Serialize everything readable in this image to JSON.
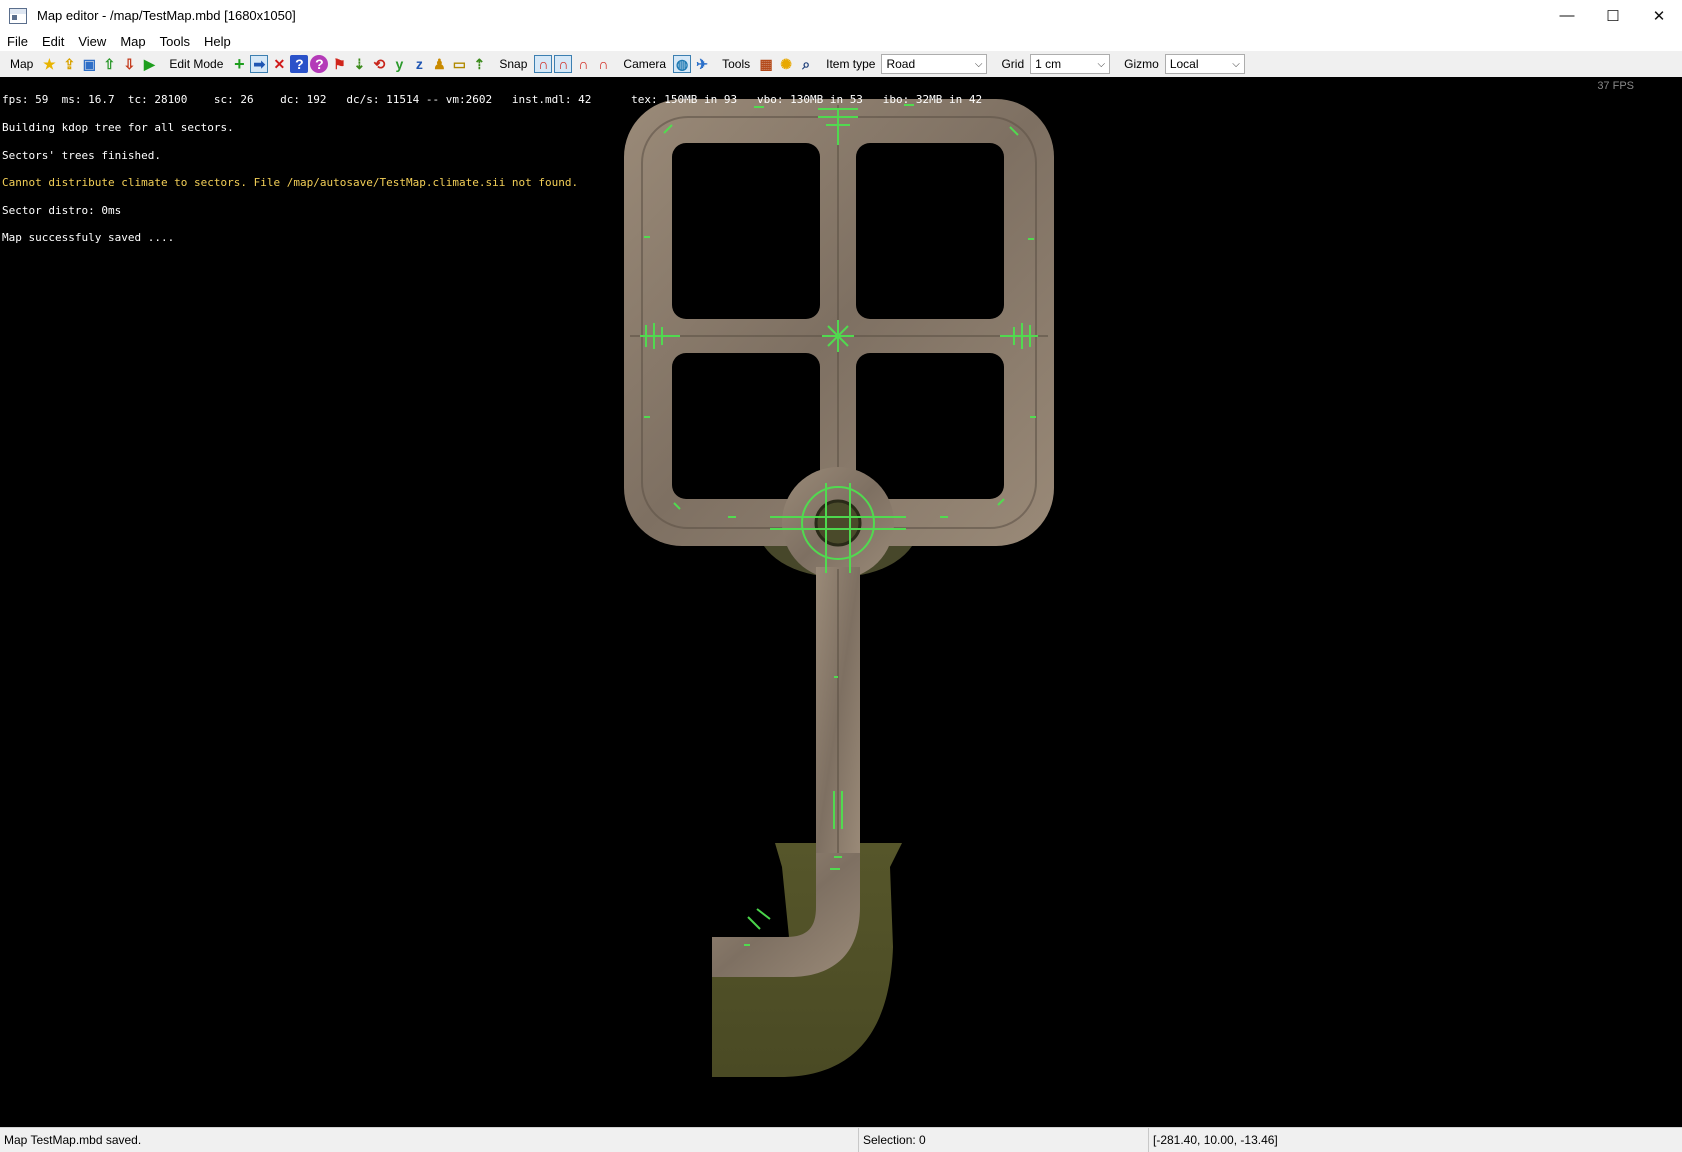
{
  "window": {
    "title": "Map editor - /map/TestMap.mbd [1680x1050]",
    "minimize_glyph": "—",
    "maximize_glyph": "☐",
    "close_glyph": "✕"
  },
  "menu": [
    "File",
    "Edit",
    "View",
    "Map",
    "Tools",
    "Help"
  ],
  "toolbar": {
    "map_label": "Map",
    "edit_mode_label": "Edit Mode",
    "snap_label": "Snap",
    "camera_label": "Camera",
    "tools_label": "Tools",
    "item_type_label": "Item type",
    "item_type_value": "Road",
    "grid_label": "Grid",
    "grid_value": "1 cm",
    "gizmo_label": "Gizmo",
    "gizmo_value": "Local",
    "icon_glyphs": {
      "star": "★",
      "upload": "⇪",
      "save": "▣",
      "export": "⇧",
      "import": "⇩",
      "play": "▶",
      "add": "+",
      "arrow": "➡",
      "delete": "✕",
      "help": "?",
      "question": "?",
      "flag": "⚑",
      "down": "⇣",
      "rot": "⟲",
      "y": "y",
      "z": "z",
      "person": "♟",
      "ruler": "▭",
      "up": "⇡",
      "magnet": "∩",
      "globe": "◍",
      "bird": "✈",
      "grid": "▦",
      "sun": "✺",
      "search": "⌕"
    }
  },
  "console": {
    "stats": "fps: 59  ms: 16.7  tc: 28100    sc: 26    dc: 192   dc/s: 11514 -- vm:2602   inst.mdl: 42      tex: 150MB in 93   vbo: 130MB in 53   ibo: 32MB in 42",
    "lines": [
      "Building kdop tree for all sectors.",
      "Sectors' trees finished.",
      "Cannot distribute climate to sectors. File /map/autosave/TestMap.climate.sii not found.",
      "Sector distro: 0ms",
      "Map successfuly saved ...."
    ],
    "fps": "37 FPS"
  },
  "status": {
    "message": "Map TestMap.mbd saved.",
    "selection": "Selection: 0",
    "coords": "[-281.40, 10.00, -13.46]"
  },
  "colors": {
    "road": "#8a7c6c",
    "road_edge": "#5e5246",
    "terrain": "#5a5a28",
    "marker": "#4fe04f",
    "warning_text": "#f3cf57"
  }
}
